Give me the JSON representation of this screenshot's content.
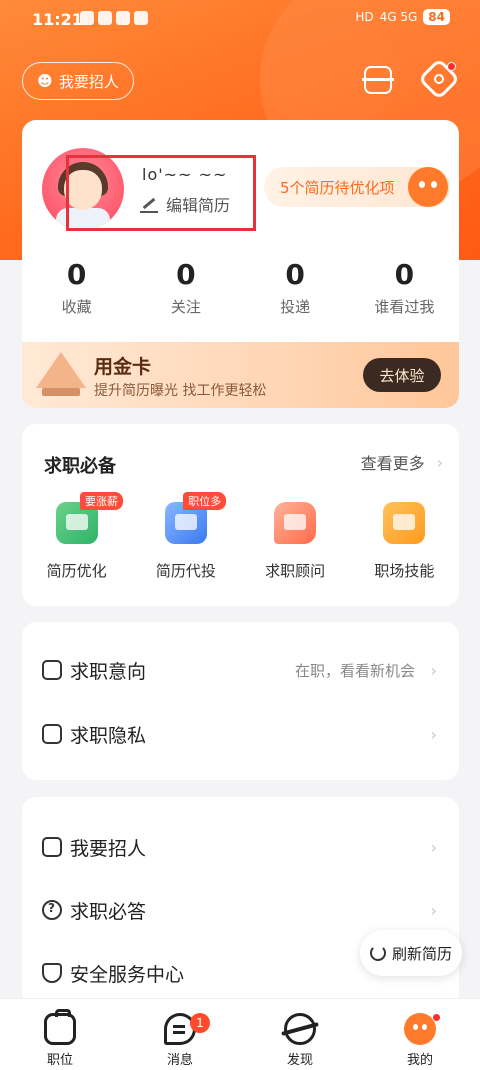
{
  "status_bar": {
    "time": "11:21",
    "app_icons": [
      "听",
      "telegram",
      "green-app",
      "blue-k-app"
    ],
    "network": "4G 5G",
    "hd": "HD",
    "battery": "84"
  },
  "header": {
    "recruit_label": "我要招人"
  },
  "profile": {
    "username": "lo'~~ ~~",
    "edit_label": "编辑简历",
    "optimize_text": "5个简历待优化项",
    "stats": [
      {
        "value": "0",
        "label": "收藏"
      },
      {
        "value": "0",
        "label": "关注"
      },
      {
        "value": "0",
        "label": "投递"
      },
      {
        "value": "0",
        "label": "谁看过我"
      }
    ],
    "gold_card": {
      "title": "用金卡",
      "subtitle": "提升简历曝光 找工作更轻松",
      "button": "去体验"
    }
  },
  "tools": {
    "title": "求职必备",
    "more": "查看更多",
    "items": [
      {
        "label": "简历优化",
        "badge": "要涨薪",
        "icon": "resume-optimize-icon",
        "color": "#2fb36a"
      },
      {
        "label": "简历代投",
        "badge": "职位多",
        "icon": "resume-delivery-icon",
        "color": "#3a7af0"
      },
      {
        "label": "求职顾问",
        "badge": "",
        "icon": "consultant-icon",
        "color": "#ff6a4a"
      },
      {
        "label": "职场技能",
        "badge": "",
        "icon": "skills-icon",
        "color": "#ff9a1e"
      }
    ]
  },
  "list1": [
    {
      "label": "求职意向",
      "hint": "在职，看看新机会",
      "icon": "intent-icon"
    },
    {
      "label": "求职隐私",
      "hint": "",
      "icon": "privacy-lock-icon"
    }
  ],
  "list2": [
    {
      "label": "我要招人",
      "icon": "briefcase-icon"
    },
    {
      "label": "求职必答",
      "icon": "question-icon"
    },
    {
      "label": "安全服务中心",
      "icon": "shield-icon"
    }
  ],
  "refresh_label": "刷新简历",
  "tabbar": [
    {
      "label": "职位",
      "icon": "job-icon"
    },
    {
      "label": "消息",
      "icon": "message-icon",
      "badge": "1"
    },
    {
      "label": "发现",
      "icon": "discover-icon"
    },
    {
      "label": "我的",
      "icon": "me-icon"
    }
  ],
  "colors": {
    "brand": "#ff6a1e",
    "badge_red": "#ff4b3a"
  }
}
